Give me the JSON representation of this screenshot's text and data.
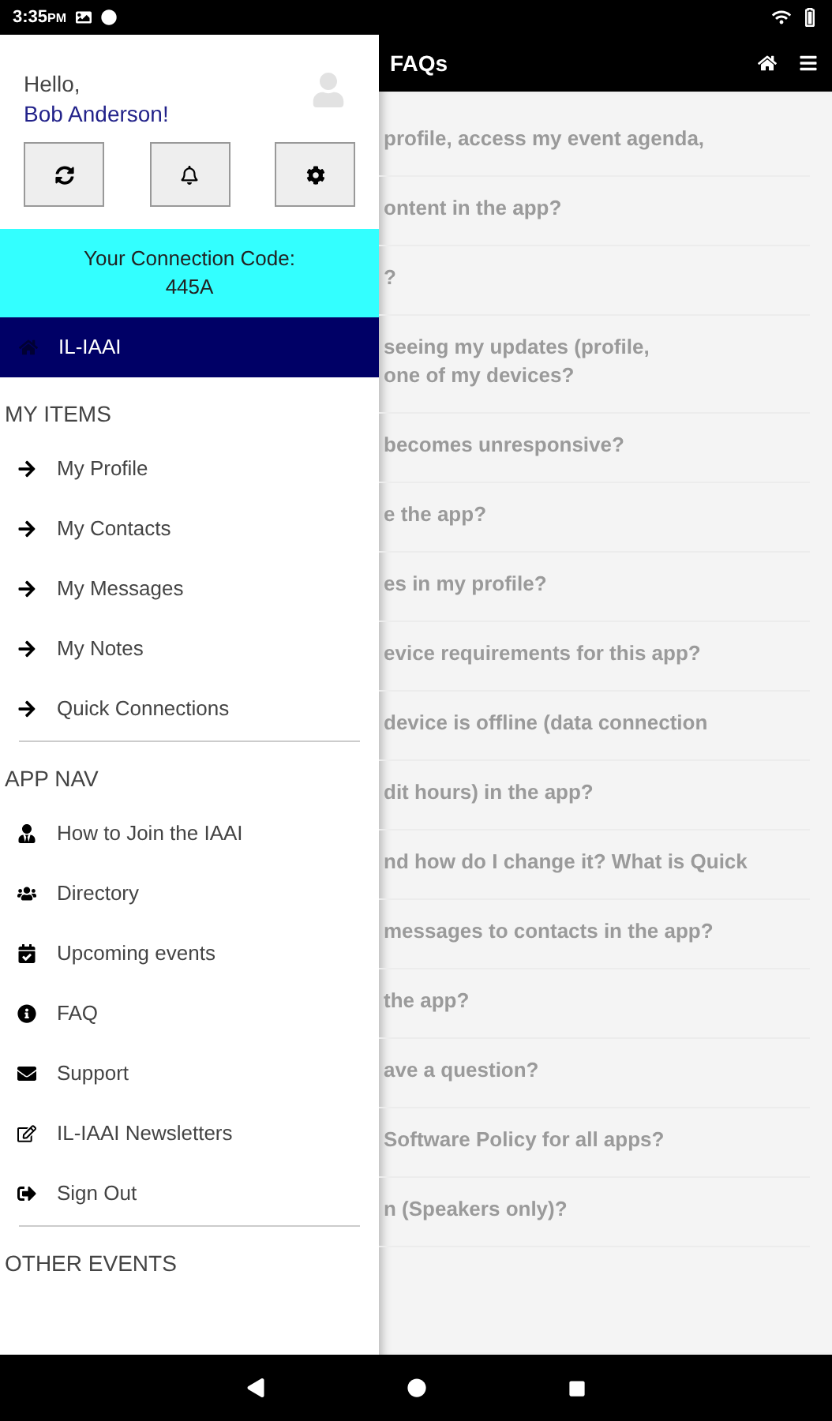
{
  "status_bar": {
    "time": "3:35",
    "meridiem": "PM"
  },
  "header": {
    "title": "FAQs"
  },
  "faq_items": [
    {
      "lines": [
        "profile, access my event agenda,"
      ]
    },
    {
      "lines": [
        "ontent in the app?"
      ]
    },
    {
      "lines": [
        "?"
      ]
    },
    {
      "lines": [
        "seeing my updates (profile,",
        "one of my devices?"
      ]
    },
    {
      "lines": [
        "becomes unresponsive?"
      ]
    },
    {
      "lines": [
        "e the app?"
      ]
    },
    {
      "lines": [
        "es in my profile?"
      ]
    },
    {
      "lines": [
        "evice requirements for this app?"
      ]
    },
    {
      "lines": [
        "device is offline (data connection"
      ]
    },
    {
      "lines": [
        "dit hours) in the app?"
      ]
    },
    {
      "lines": [
        "nd how do I change it? What is Quick"
      ]
    },
    {
      "lines": [
        "messages to contacts in the app?"
      ]
    },
    {
      "lines": [
        "the app?"
      ]
    },
    {
      "lines": [
        "ave a question?"
      ]
    },
    {
      "lines": [
        "Software Policy for all apps?"
      ]
    },
    {
      "lines": [
        "n (Speakers only)?"
      ]
    }
  ],
  "drawer": {
    "greeting": "Hello,",
    "user_name": "Bob Anderson!",
    "connection_label": "Your Connection Code:",
    "connection_code": "445A",
    "current_event": "IL-IAAI",
    "sections": [
      {
        "heading": "MY ITEMS",
        "items": [
          "My Profile",
          "My Contacts",
          "My Messages",
          "My Notes",
          "Quick Connections"
        ]
      },
      {
        "heading": "APP NAV",
        "items": [
          "How to Join the IAAI",
          "Directory",
          "Upcoming events",
          "FAQ",
          "Support",
          "IL-IAAI Newsletters",
          "Sign Out"
        ]
      },
      {
        "heading": "OTHER EVENTS"
      }
    ]
  }
}
